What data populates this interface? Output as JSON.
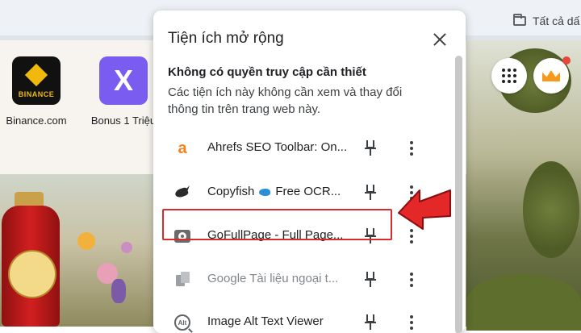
{
  "browser": {
    "bookmarks_bar": {
      "all_bookmarks_label": "Tất cả dấ"
    }
  },
  "new_tab": {
    "shortcuts": [
      {
        "label": "Binance.com",
        "tile_text": "BINANCE"
      },
      {
        "label": "Bonus 1 Triệu",
        "tile_text": "X"
      }
    ]
  },
  "extensions_panel": {
    "title": "Tiện ích mở rộng",
    "section_heading": "Không có quyền truy cập cần thiết",
    "section_description": "Các tiện ích này không cần xem và thay đổi thông tin trên trang web này.",
    "items": [
      {
        "name": "Ahrefs SEO Toolbar: On...",
        "icon": "ahrefs-icon",
        "dimmed": false
      },
      {
        "name_prefix": "Copyfish",
        "name_suffix": "Free OCR...",
        "icon": "copyfish-icon",
        "dimmed": false
      },
      {
        "name": "GoFullPage - Full Page...",
        "icon": "camera-icon",
        "dimmed": false,
        "highlighted": true
      },
      {
        "name": "Google Tài liệu ngoại t...",
        "icon": "google-docs-offline-icon",
        "dimmed": true
      },
      {
        "name": "Image Alt Text Viewer",
        "icon": "alt-text-icon",
        "dimmed": false
      }
    ]
  },
  "annotation": {
    "highlight_color": "#d92b2b"
  }
}
